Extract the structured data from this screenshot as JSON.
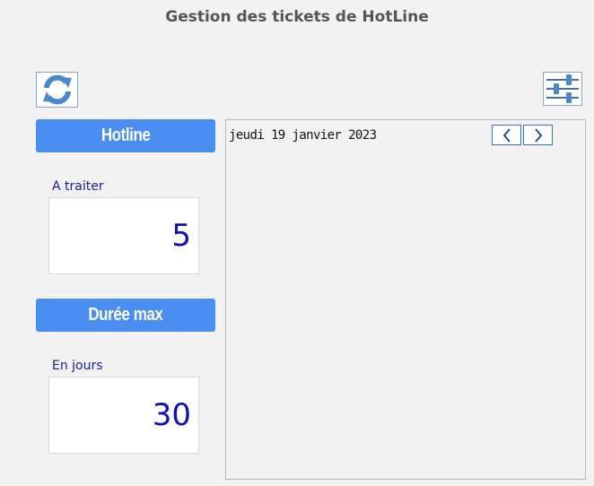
{
  "header": {
    "title": "Gestion des tickets de HotLine"
  },
  "toolbar": {
    "refresh_icon": "refresh-icon",
    "settings_icon": "sliders-icon"
  },
  "hotline": {
    "button_label": "Hotline",
    "field_label": "A traiter",
    "value": "5"
  },
  "duree": {
    "button_label": "Durée max",
    "field_label": "En jours",
    "value": "30"
  },
  "calendar": {
    "date": "jeudi 19 janvier 2023",
    "prev_icon": "chevron-left-icon",
    "next_icon": "chevron-right-icon"
  },
  "colors": {
    "accent": "#4a8ef2",
    "value_text": "#1010b8",
    "label_text": "#1a1aa8"
  }
}
